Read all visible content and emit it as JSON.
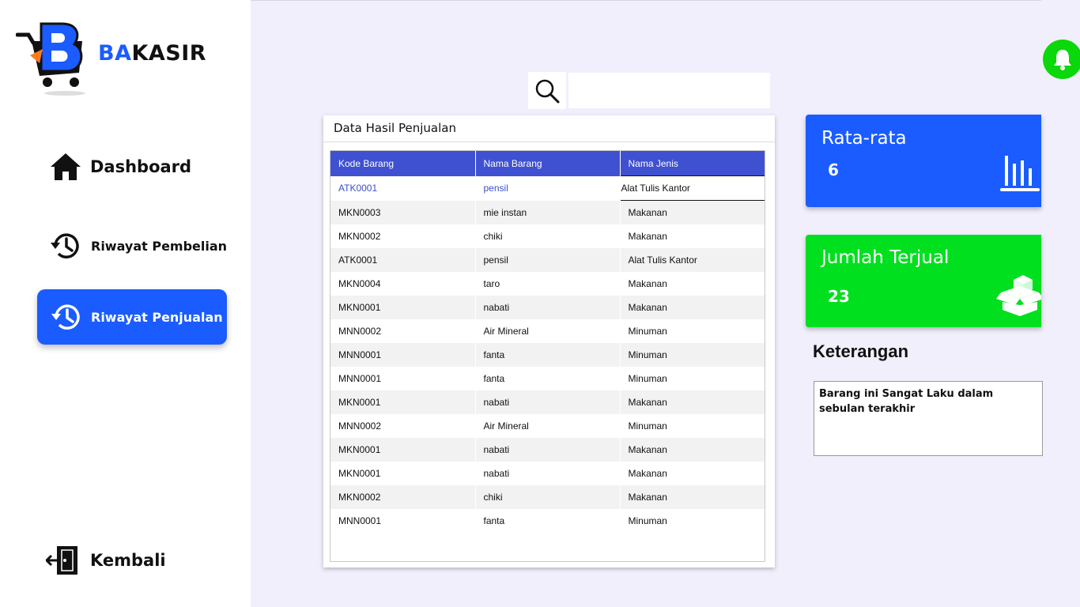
{
  "brand": {
    "prefix": "BA",
    "suffix": "KASIR"
  },
  "nav": {
    "dashboard": "Dashboard",
    "riwayat_pembelian": "Riwayat Pembelian",
    "riwayat_penjualan": "Riwayat Penjualan",
    "kembali": "Kembali"
  },
  "search": {
    "placeholder": ""
  },
  "table": {
    "title": "Data Hasil Penjualan",
    "columns": [
      "Kode Barang",
      "Nama Barang",
      "Nama Jenis"
    ],
    "rows": [
      [
        "ATK0001",
        "pensil",
        "Alat Tulis Kantor"
      ],
      [
        "MKN0003",
        "mie instan",
        "Makanan"
      ],
      [
        "MKN0002",
        "chiki",
        "Makanan"
      ],
      [
        "ATK0001",
        "pensil",
        "Alat Tulis Kantor"
      ],
      [
        "MKN0004",
        "taro",
        "Makanan"
      ],
      [
        "MKN0001",
        "nabati",
        "Makanan"
      ],
      [
        "MNN0002",
        "Air Mineral",
        "Minuman"
      ],
      [
        "MNN0001",
        "fanta",
        "Minuman"
      ],
      [
        "MNN0001",
        "fanta",
        "Minuman"
      ],
      [
        "MKN0001",
        "nabati",
        "Makanan"
      ],
      [
        "MNN0002",
        "Air Mineral",
        "Minuman"
      ],
      [
        "MKN0001",
        "nabati",
        "Makanan"
      ],
      [
        "MKN0001",
        "nabati",
        "Makanan"
      ],
      [
        "MKN0002",
        "chiki",
        "Makanan"
      ],
      [
        "MNN0001",
        "fanta",
        "Minuman"
      ]
    ],
    "selected_row": 0
  },
  "cards": {
    "average": {
      "title": "Rata-rata",
      "value": "6",
      "icon": "bar-chart-icon",
      "color": "#1a5cff"
    },
    "sold": {
      "title": "Jumlah Terjual",
      "value": "23",
      "icon": "open-box-icon",
      "color": "#00e01f"
    }
  },
  "keterangan": {
    "title": "Keterangan",
    "text": "Barang ini Sangat Laku dalam sebulan terakhir"
  },
  "colors": {
    "accent": "#1a5cff",
    "table_header": "#3f51d1",
    "bell": "#0bd80b",
    "background": "#f0effb"
  }
}
